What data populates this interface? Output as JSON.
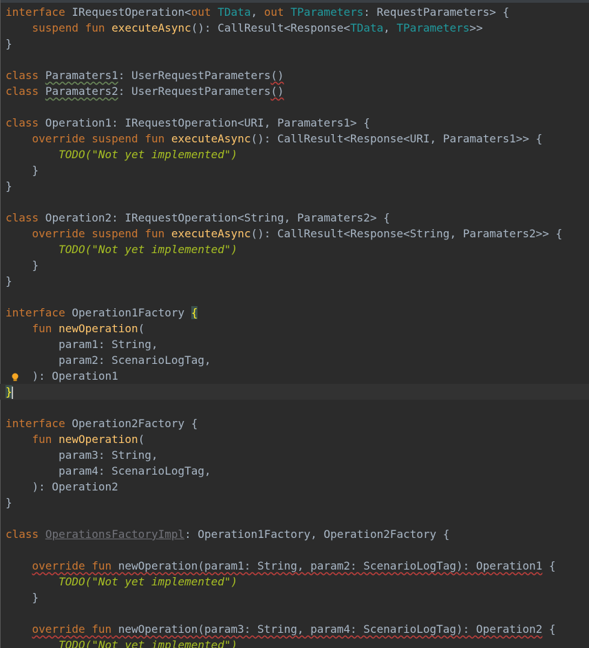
{
  "editor": {
    "language": "Kotlin",
    "caret_line": 24,
    "code_lines": [
      "interface IRequestOperation<out TData, out TParameters: RequestParameters> {",
      "    suspend fun executeAsync(): CallResult<Response<TData, TParameters>>",
      "}",
      "",
      "class Paramaters1: UserRequestParameters()",
      "class Paramaters2: UserRequestParameters()",
      "",
      "class Operation1: IRequestOperation<URI, Paramaters1> {",
      "    override suspend fun executeAsync(): CallResult<Response<URI, Paramaters1>> {",
      "        TODO(\"Not yet implemented\")",
      "    }",
      "}",
      "",
      "class Operation2: IRequestOperation<String, Paramaters2> {",
      "    override suspend fun executeAsync(): CallResult<Response<String, Paramaters2>> {",
      "        TODO(\"Not yet implemented\")",
      "    }",
      "}",
      "",
      "interface Operation1Factory {",
      "    fun newOperation(",
      "        param1: String,",
      "        param2: ScenarioLogTag,",
      "    ): Operation1",
      "}",
      "",
      "interface Operation2Factory {",
      "    fun newOperation(",
      "        param3: String,",
      "        param4: ScenarioLogTag,",
      "    ): Operation2",
      "}",
      "",
      "class OperationsFactoryImpl: Operation1Factory, Operation2Factory {",
      "",
      "    override fun newOperation(param1: String, param2: ScenarioLogTag): Operation1 {",
      "        TODO(\"Not yet implemented\")",
      "    }",
      "",
      "    override fun newOperation(param3: String, param4: ScenarioLogTag): Operation2 {",
      "        TODO(\"Not yet implemented\")"
    ]
  },
  "colors": {
    "background": "#2b2b2b",
    "text": "#a9b7c6",
    "keyword": "#cc7832",
    "type_param": "#20999d",
    "function": "#ffc66d",
    "todo": "#a8c023",
    "current_line": "#323232",
    "error_underline": "#bc3f3c"
  },
  "icons": {
    "intention_bulb": "lightbulb-icon"
  }
}
